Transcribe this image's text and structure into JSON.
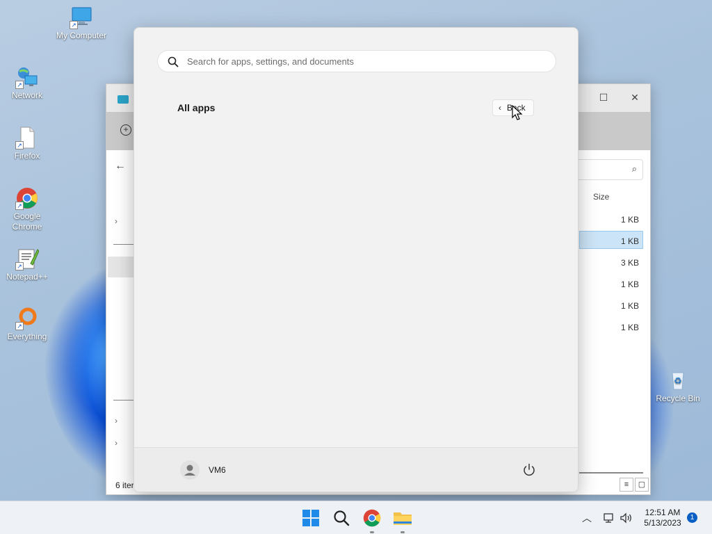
{
  "desktop": {
    "icons": [
      {
        "label": "My Computer"
      },
      {
        "label": "Network"
      },
      {
        "label": "Firefox"
      },
      {
        "label": "Google Chrome"
      },
      {
        "label": "Notepad++"
      },
      {
        "label": "Everything"
      },
      {
        "label": "Recycle Bin"
      }
    ]
  },
  "explorer": {
    "size_header": "Size",
    "sizes": [
      "1 KB",
      "1 KB",
      "3 KB",
      "1 KB",
      "1 KB",
      "1 KB"
    ],
    "status": "6 iter"
  },
  "start_menu": {
    "search_placeholder": "Search for apps, settings, and documents",
    "heading": "All apps",
    "back_label": "Back",
    "user_name": "VM6"
  },
  "taskbar": {
    "time": "12:51 AM",
    "date": "5/13/2023",
    "notification_count": "1",
    "accent": "#0a5fc4"
  }
}
